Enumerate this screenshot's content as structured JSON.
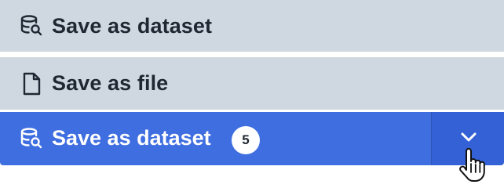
{
  "menu": {
    "items": [
      {
        "label": "Save as dataset",
        "icon": "dataset-search-icon"
      },
      {
        "label": "Save as file",
        "icon": "file-icon"
      }
    ]
  },
  "split_button": {
    "label": "Save as dataset",
    "icon": "dataset-search-icon",
    "badge": "5",
    "toggle_icon": "chevron-down-icon"
  },
  "colors": {
    "menu_bg": "#cfd8e1",
    "primary": "#3f6ee0",
    "primary_dark": "#3462d6",
    "text_dark": "#1f2733"
  },
  "cursor": "pointer-hand-icon"
}
